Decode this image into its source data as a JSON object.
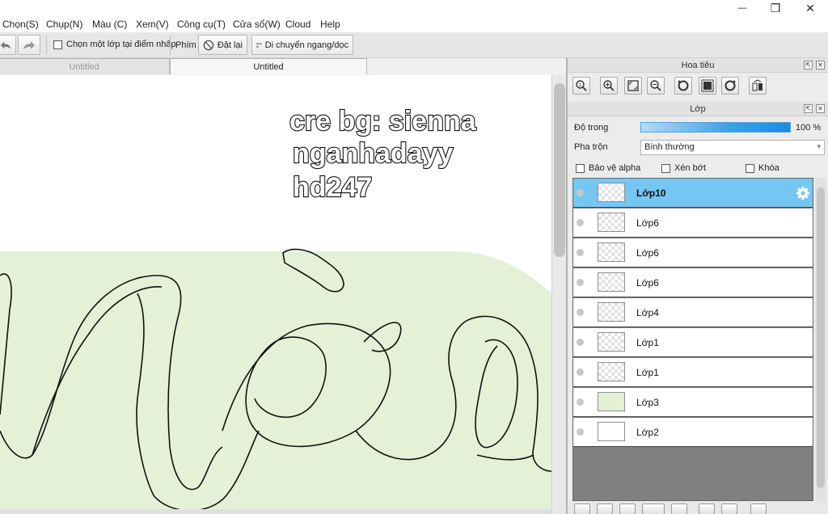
{
  "menu": {
    "items": [
      "Chọn(S)",
      "Chụp(N)",
      "Màu (C)",
      "Xem(V)",
      "Công cụ(T)",
      "Cửa sổ(W)",
      "Cloud",
      "Help"
    ]
  },
  "window_controls": {
    "minimize_glyph": "—",
    "maximize_glyph": "❐",
    "close_glyph": "✕"
  },
  "toolbar": {
    "select_layer_label": "Chọn một lớp tại điểm nhấp",
    "phim_label": "Phím",
    "reset_label": "Đặt lại",
    "move_label": "Di chuyển ngang/dọc"
  },
  "tabs": [
    {
      "label": "Untitled",
      "active": false
    },
    {
      "label": "Untitled",
      "active": true
    }
  ],
  "canvas": {
    "credit_lines": [
      "cre bg: sienna",
      "nganhadayy",
      "hd247"
    ],
    "background_fill": "#e4f1d6"
  },
  "navigator": {
    "title": "Hoa tiêu",
    "icons": [
      "zoom-fit-icon",
      "zoom-in-icon",
      "fit-screen-icon",
      "zoom-out-icon",
      "rotate-left-icon",
      "reset-view-icon",
      "rotate-right-icon",
      "flip-icon"
    ]
  },
  "layers_panel": {
    "title": "Lớp",
    "opacity_label": "Độ trong",
    "opacity_value": "100 %",
    "blend_label": "Pha trộn",
    "blend_value": "Bình thường",
    "protect_alpha_label": "Bảo vệ alpha",
    "clipping_label": "Xén bớt",
    "lock_label": "Khóa",
    "layers": [
      {
        "name": "Lớp10",
        "active": true,
        "thumb": "checker"
      },
      {
        "name": "Lớp6",
        "active": false,
        "thumb": "checker"
      },
      {
        "name": "Lớp6",
        "active": false,
        "thumb": "checker"
      },
      {
        "name": "Lớp6",
        "active": false,
        "thumb": "checker"
      },
      {
        "name": "Lớp4",
        "active": false,
        "thumb": "checker"
      },
      {
        "name": "Lớp1",
        "active": false,
        "thumb": "checker"
      },
      {
        "name": "Lớp1",
        "active": false,
        "thumb": "checker"
      },
      {
        "name": "Lớp3",
        "active": false,
        "thumb": "green"
      },
      {
        "name": "Lớp2",
        "active": false,
        "thumb": "white"
      }
    ]
  },
  "colors": {
    "accent_blue": "#76c6f4",
    "canvas_green": "#e4f1d6"
  }
}
